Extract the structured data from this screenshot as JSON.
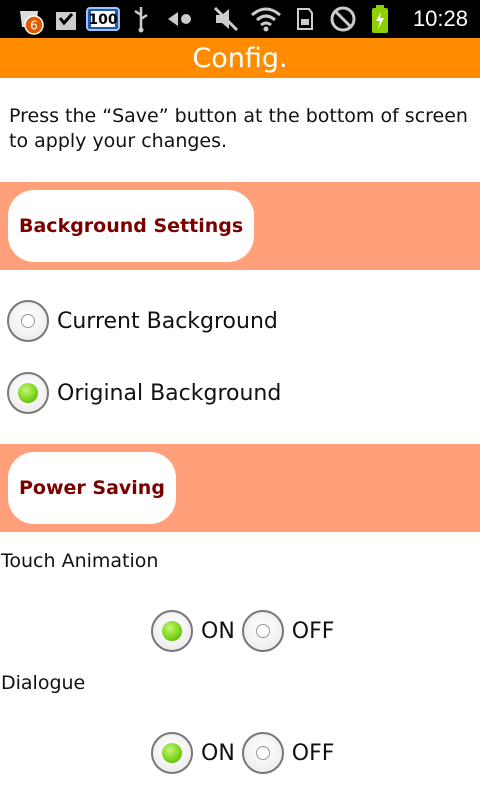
{
  "status_bar": {
    "notification_count": "6",
    "battery_level": "100",
    "time": "10:28",
    "icons": [
      "notification-icon",
      "download-icon",
      "battery-100-icon",
      "usb-icon",
      "tethering-icon",
      "mute-icon",
      "wifi-icon",
      "sdcard-icon",
      "blocked-icon",
      "charging-battery-icon"
    ]
  },
  "title": "Config.",
  "instructions": "Press the “Save” button at the bottom of screen to apply your changes.",
  "sections": {
    "background": {
      "header": "Background Settings",
      "options": [
        {
          "label": "Current Background",
          "checked": false
        },
        {
          "label": "Original Background",
          "checked": true
        }
      ]
    },
    "power": {
      "header": "Power Saving",
      "settings": [
        {
          "label": "Touch Animation",
          "on_label": "ON",
          "off_label": "OFF",
          "value": "ON"
        },
        {
          "label": "Dialogue",
          "on_label": "ON",
          "off_label": "OFF",
          "value": "ON"
        }
      ]
    }
  },
  "colors": {
    "title_bar": "#ff8c00",
    "section_header": "#ffa07a",
    "section_text": "#7a0000",
    "radio_checked": "#7bd61c"
  }
}
